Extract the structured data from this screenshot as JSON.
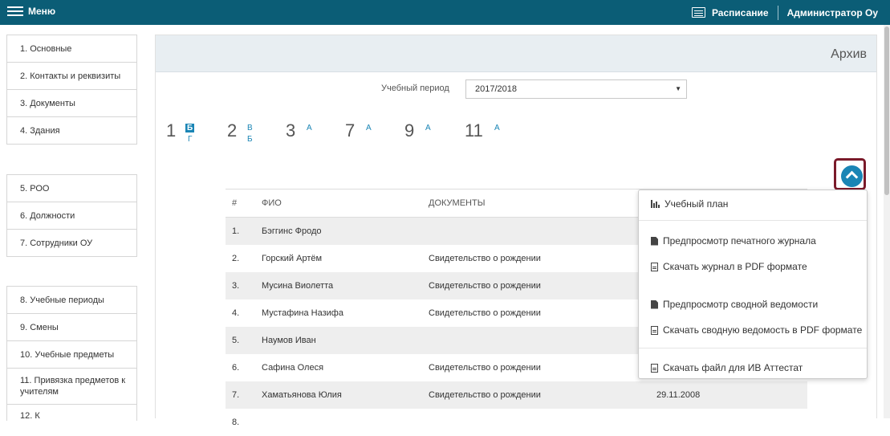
{
  "topbar": {
    "menu_label": "Меню",
    "schedule_label": "Расписание",
    "admin_label": "Администратор Оу"
  },
  "sidebar": {
    "group1": [
      "1.  Основные",
      "2.  Контакты и реквизиты",
      "3.  Документы",
      "4.  Здания"
    ],
    "group2": [
      "5.  РОО",
      "6.  Должности",
      "7.  Сотрудники ОУ"
    ],
    "group3": [
      "8.  Учебные периоды",
      "9.  Смены",
      "10. Учебные предметы",
      "11. Привязка предметов к учителям",
      "12. К"
    ]
  },
  "main": {
    "title": "Архив",
    "period_label": "Учебный период",
    "period_value": "2017/2018",
    "classes": [
      {
        "num": "1",
        "letters": [
          "Б",
          "Г"
        ]
      },
      {
        "num": "2",
        "letters": [
          "В",
          "Б"
        ]
      },
      {
        "num": "3",
        "letters": [
          "А"
        ]
      },
      {
        "num": "7",
        "letters": [
          "А"
        ]
      },
      {
        "num": "9",
        "letters": [
          "А"
        ]
      },
      {
        "num": "11",
        "letters": [
          "А"
        ]
      }
    ],
    "table": {
      "headers": [
        "#",
        "ФИО",
        "ДОКУМЕНТЫ",
        ""
      ],
      "rows": [
        [
          "1.",
          "Бэггинс Фродо",
          "",
          ""
        ],
        [
          "2.",
          "Горский Артём",
          "Свидетельство о рождении",
          ""
        ],
        [
          "3.",
          "Мусина Виолетта",
          "Свидетельство о рождении",
          ""
        ],
        [
          "4.",
          "Мустафина Назифа",
          "Свидетельство о рождении",
          ""
        ],
        [
          "5.",
          "Наумов Иван",
          "",
          ""
        ],
        [
          "6.",
          "Сафина Олеся",
          "Свидетельство о рождении",
          ""
        ],
        [
          "7.",
          "Хаматьянова Юлия",
          "Свидетельство о рождении",
          "29.11.2008"
        ],
        [
          "8.",
          "",
          "",
          ""
        ]
      ]
    }
  },
  "dropdown": {
    "items": [
      "Учебный план",
      "Предпросмотр печатного журнала",
      "Скачать журнал в PDF формате",
      "Предпросмотр сводной ведомости",
      "Скачать сводную ведомость в PDF формате",
      "Скачать файл для ИВ Аттестат"
    ]
  },
  "colors": {
    "topbar": "#0b5d76",
    "accent": "#1a85b5",
    "highlight_border": "#7a1a2a"
  }
}
